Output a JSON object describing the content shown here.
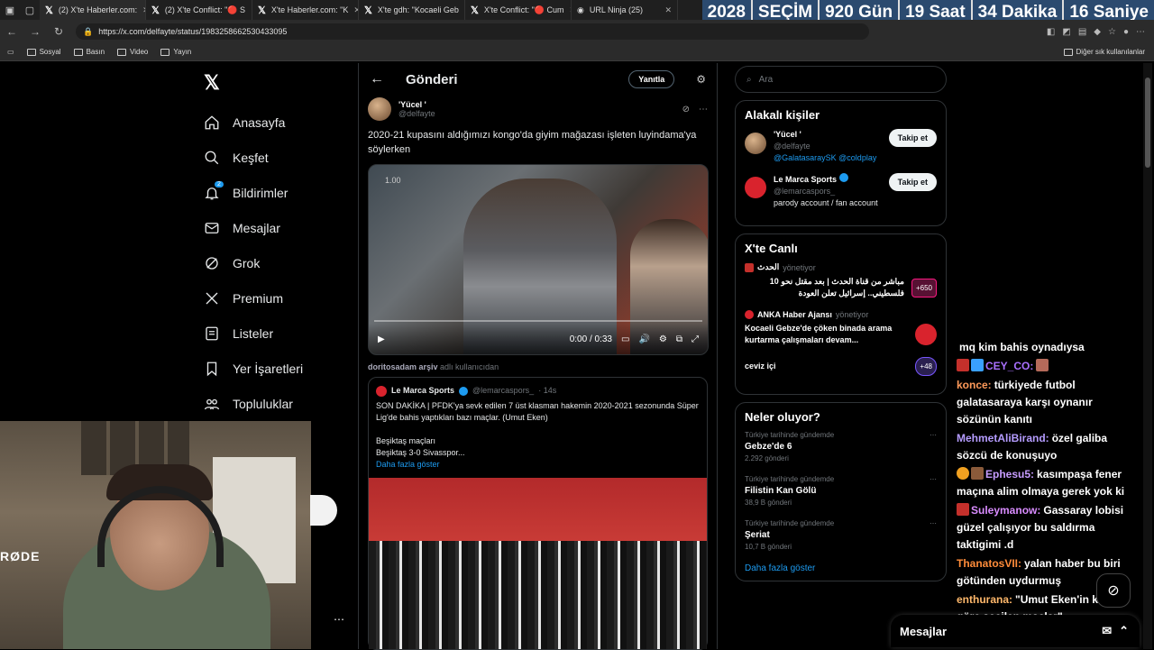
{
  "browser": {
    "tabs": [
      {
        "label": "(2) X'te Haberler.com: "
      },
      {
        "label": "(2) X'te Conflict: \"🔴 S"
      },
      {
        "label": "X'te Haberler.com: \"K"
      },
      {
        "label": "X'te gdh: \"Kocaeli Geb"
      },
      {
        "label": "X'te Conflict: \"🔴 Cum"
      },
      {
        "label": "URL Ninja (25)"
      }
    ],
    "url": "https://x.com/delfayte/status/1983258662530433095",
    "bookmarks": [
      "Sosyal",
      "Basın",
      "Video",
      "Yayın"
    ],
    "other_bookmarks": "Diğer sık kullanılanlar"
  },
  "countdown": {
    "year": "2028",
    "label": "SEÇİM",
    "days": "920 Gün",
    "hours": "19 Saat",
    "minutes": "34 Dakika",
    "seconds": "16 Saniye"
  },
  "nav": {
    "items": [
      {
        "label": "Anasayfa"
      },
      {
        "label": "Keşfet"
      },
      {
        "label": "Bildirimler",
        "badge": "2"
      },
      {
        "label": "Mesajlar"
      },
      {
        "label": "Grok"
      },
      {
        "label": "Premium"
      },
      {
        "label": "Listeler"
      },
      {
        "label": "Yer İşaretleri"
      },
      {
        "label": "Topluluklar"
      }
    ]
  },
  "main": {
    "title": "Gönderi",
    "reply_button": "Yanıtla",
    "author_name": "'Yücel '",
    "author_handle": "@delfayte",
    "text": "2020-21 kupasını aldığımızı kongo'da giyim mağazası işleten luyindama'ya söylerken",
    "video_speed": "1.00",
    "video_time": "0:00 / 0:33",
    "repost_user": "doritosadam arşiv",
    "repost_suffix": "adlı kullanıcıdan",
    "quote": {
      "name": "Le Marca Sports",
      "handle": "@lemarcaspors_",
      "time": "· 14s",
      "text1": "SON DAKİKA | PFDK'ya sevk edilen 7 üst klasman hakemin 2020-2021 sezonunda Süper Lig'de bahis yaptıkları bazı maçlar. (Umut Eken)",
      "text2": "Beşiktaş maçları",
      "text3": "Beşiktaş 3-0 Sivasspor...",
      "more": "Daha fazla göster"
    }
  },
  "right": {
    "search_placeholder": "Ara",
    "related_title": "Alakalı kişiler",
    "people": [
      {
        "name": "'Yücel '",
        "handle": "@delfayte",
        "bio": "@GalatasaraySK @coldplay",
        "follow": "Takip et"
      },
      {
        "name": "Le Marca Sports",
        "handle": "@lemarcaspors_",
        "bio": "parody account / fan account",
        "follow": "Takip et"
      }
    ],
    "live_title": "X'te Canlı",
    "live": [
      {
        "source": "الحدث",
        "role": "yönetiyor",
        "text": "مباشر من قناة الحدث | بعد مقتل نحو 10 فلسطيني.. إسرائيل تعلن العودة",
        "count": "+650"
      },
      {
        "source": "ANKA Haber Ajansı",
        "role": "yönetiyor",
        "text": "Kocaeli Gebze'de çöken binada arama kurtarma çalışmaları devam...",
        "count": ""
      },
      {
        "source": "",
        "role": "",
        "text": "ceviz içi",
        "count": "+48"
      }
    ],
    "trends_title": "Neler oluyor?",
    "trends": [
      {
        "category": "Türkiye tarihinde gündemde",
        "name": "Gebze'de 6",
        "count": "2.292 gönderi"
      },
      {
        "category": "Türkiye tarihinde gündemde",
        "name": "Filistin Kan Gölü",
        "count": "38,9 B gönderi"
      },
      {
        "category": "Türkiye tarihinde gündemde",
        "name": "Şeriat",
        "count": "10,7 B gönderi"
      }
    ],
    "trends_more": "Daha fazla göster"
  },
  "chat": {
    "messages": [
      {
        "user": "",
        "text": "mq kim bahis oynadıysa",
        "color": "#ffffff"
      },
      {
        "user": "CEY_CO:",
        "text": "",
        "color": "#a970ff"
      },
      {
        "user": "konce:",
        "text": "türkiyede futbol galatasaraya karşı oynanır sözünün kanıtı",
        "color": "#ff9a5a"
      },
      {
        "user": "MehmetAliBirand:",
        "text": "özel galiba sözcü de konuşuyo",
        "color": "#b59cff"
      },
      {
        "user": "Ephesu5:",
        "text": "kasımpaşa fener maçına alim olmaya gerek yok ki",
        "color": "#c79cff"
      },
      {
        "user": "Suleymanow:",
        "text": "Gassaray lobisi güzel çalışıyor bu saldırma taktigimi .d",
        "color": "#d98cff"
      },
      {
        "user": "ThanatosVII:",
        "text": "yalan haber bu biri götünden uydurmuş",
        "color": "#ff8c3a"
      },
      {
        "user": "enthurana:",
        "text": "\"Umut Eken'in keyfine göre seçilen maçlar\"",
        "color": "#ffb86b"
      }
    ]
  },
  "messages_bar": "Mesajlar"
}
